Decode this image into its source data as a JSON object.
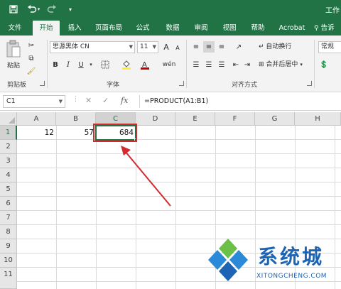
{
  "titlebar": {
    "save_icon": "save-icon",
    "undo_icon": "undo-icon",
    "redo_icon": "redo-icon",
    "title_partial": "工作"
  },
  "tabs": [
    "文件",
    "开始",
    "插入",
    "页面布局",
    "公式",
    "数据",
    "审阅",
    "视图",
    "帮助",
    "Acrobat",
    "告诉"
  ],
  "ribbon": {
    "clipboard": {
      "paste_label": "粘贴",
      "group_label": "剪贴板"
    },
    "font": {
      "font_name": "思源黑体 CN",
      "font_size": "11",
      "bold": "B",
      "italic": "I",
      "underline": "U",
      "grow": "A",
      "shrink": "A",
      "group_label": "字体",
      "font_color": "#c00000"
    },
    "alignment": {
      "wrap_text": "自动换行",
      "merge_center": "合并后居中",
      "group_label": "对齐方式"
    },
    "number": {
      "format": "常规"
    }
  },
  "formula_bar": {
    "name_box": "C1",
    "cancel": "✕",
    "enter": "✓",
    "fx": "fx",
    "formula": "=PRODUCT(A1:B1)"
  },
  "sheet": {
    "columns": [
      "A",
      "B",
      "C",
      "D",
      "E",
      "F",
      "G",
      "H"
    ],
    "rows": [
      "1",
      "2",
      "3",
      "4",
      "5",
      "6",
      "7",
      "8",
      "9",
      "10",
      "11"
    ],
    "cells": {
      "A1": "12",
      "B1": "57",
      "C1": "684"
    },
    "selected_cell": "C1"
  },
  "watermark": {
    "text": "系统城",
    "url": "XITONGCHENG.COM"
  },
  "colors": {
    "accent": "#217346",
    "highlight": "#d12b30",
    "watermark": "#1e64b4"
  }
}
